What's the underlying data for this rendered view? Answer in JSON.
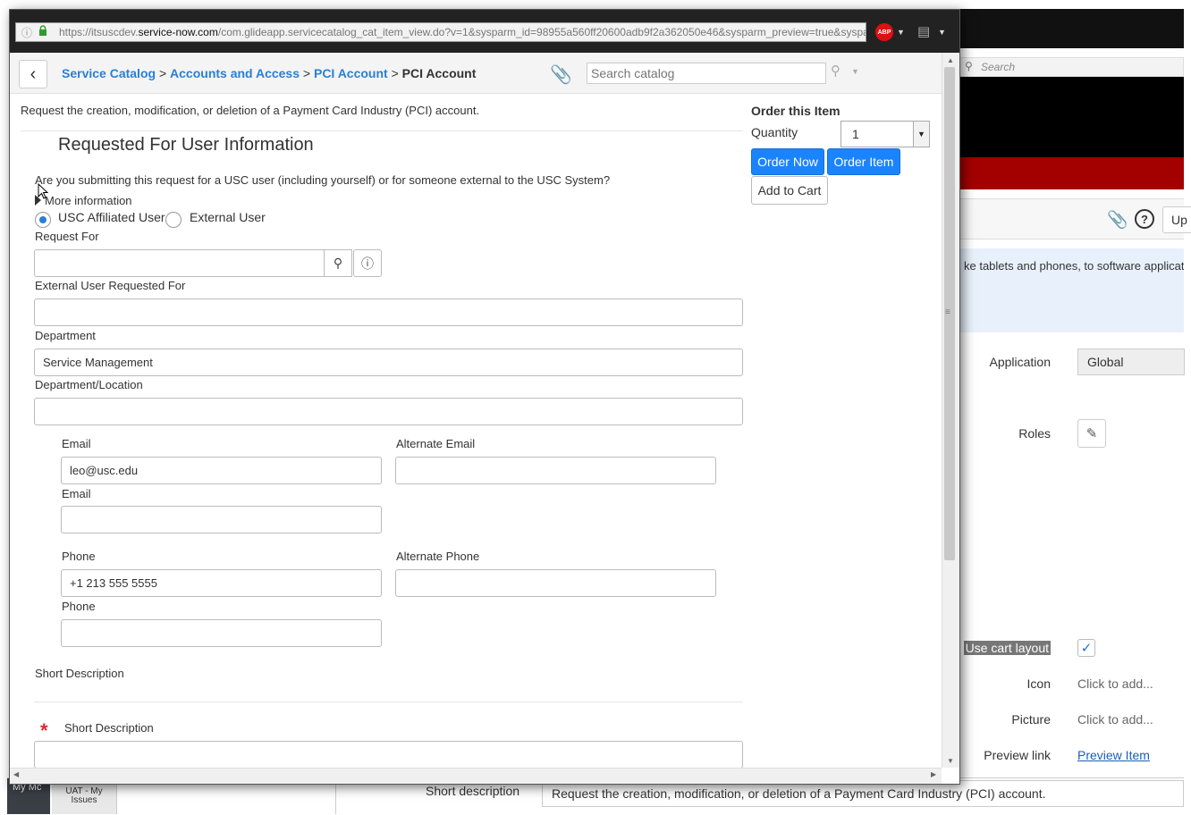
{
  "browser": {
    "url_prefix": "https://itsuscdev.",
    "url_host": "service-now.com",
    "url_path": "/com.glideapp.servicecatalog_cat_item_view.do?v=1&sysparm_id=98955a560ff20600adb9f2a362050e46&sysparm_preview=true&syspar",
    "adblock_label": "ABP"
  },
  "header": {
    "crumbs": [
      "Service Catalog",
      "Accounts and Access",
      "PCI Account"
    ],
    "current": "PCI Account",
    "separator": ">",
    "search_placeholder": "Search catalog"
  },
  "form": {
    "description": "Request the creation, modification, or deletion of a Payment Card Industry (PCI) account.",
    "section_title": "Requested For User Information",
    "question": "Are you submitting this request for a USC user (including yourself) or for someone external to the USC System?",
    "more_info": "More information",
    "radio_usc": "USC Affiliated User",
    "radio_external": "External User",
    "request_for_label": "Request For",
    "external_user_label": "External User Requested For",
    "department_label": "Department",
    "department_value": "Service Management",
    "dept_location_label": "Department/Location",
    "email_label": "Email",
    "email_value": "leo@usc.edu",
    "alt_email_label": "Alternate Email",
    "email2_label": "Email",
    "phone_label": "Phone",
    "phone_value": "+1 213 555 5555",
    "alt_phone_label": "Alternate Phone",
    "phone2_label": "Phone",
    "short_desc_heading": "Short Description",
    "short_desc_label": "Short Description",
    "required_mark": "*"
  },
  "order": {
    "title": "Order this Item",
    "quantity_label": "Quantity",
    "quantity_value": "1",
    "order_now": "Order Now",
    "order_item": "Order Item",
    "add_to_cart": "Add to Cart"
  },
  "background": {
    "search_placeholder": "Search",
    "info_text": "ke tablets and phones, to software applicat",
    "update_btn": "Up",
    "application_label": "Application",
    "application_value": "Global",
    "roles_label": "Roles",
    "use_cart_label": "Use cart layout",
    "icon_label": "Icon",
    "icon_value": "Click to add...",
    "picture_label": "Picture",
    "picture_value": "Click to add...",
    "preview_label": "Preview link",
    "preview_value": "Preview Item",
    "short_desc_label": "Short description",
    "short_desc_value": "Request the creation, modification, or deletion of a Payment Card Industry (PCI) account.",
    "taskbar_label1": "My Mc",
    "taskbar_label2": "UAT - My Issues"
  }
}
